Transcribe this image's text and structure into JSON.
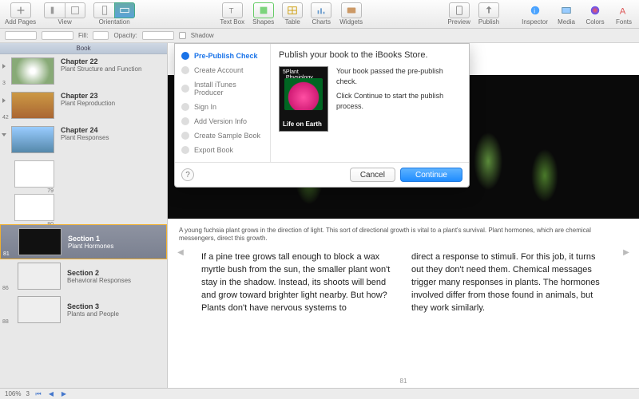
{
  "toolbar": {
    "add_pages": "Add Pages",
    "view": "View",
    "orientation": "Orientation",
    "text_box": "Text Box",
    "shapes": "Shapes",
    "table": "Table",
    "charts": "Charts",
    "widgets": "Widgets",
    "preview": "Preview",
    "publish": "Publish",
    "inspector": "Inspector",
    "media": "Media",
    "colors": "Colors",
    "fonts": "Fonts"
  },
  "subbar": {
    "fill": "Fill:",
    "opacity": "Opacity:",
    "shadow": "Shadow"
  },
  "sidebar": {
    "header": "Book",
    "chapters": [
      {
        "title": "Chapter 22",
        "sub": "Plant Structure and Function",
        "num": "3"
      },
      {
        "title": "Chapter 23",
        "sub": "Plant Reproduction",
        "num": "42"
      },
      {
        "title": "Chapter 24",
        "sub": "Plant Responses",
        "num": ""
      }
    ],
    "pages": [
      {
        "num": "79"
      },
      {
        "num": "80"
      }
    ],
    "sections": [
      {
        "title": "Section 1",
        "sub": "Plant Hormones",
        "num": "81"
      },
      {
        "title": "Section 2",
        "sub": "Behavioral Responses",
        "num": "86"
      },
      {
        "title": "Section 3",
        "sub": "Plants and People",
        "num": "88"
      }
    ]
  },
  "modal": {
    "steps": [
      "Pre-Publish Check",
      "Create Account",
      "Install iTunes Producer",
      "Sign In",
      "Add Version Info",
      "Create Sample Book",
      "Export Book"
    ],
    "title": "Publish your book to the iBooks Store.",
    "cover_num": "5",
    "cover_subject": "Plant Physiology",
    "cover_title": "Life on Earth",
    "msg1": "Your book passed the pre-publish check.",
    "msg2": "Click Continue to start the publish process.",
    "help": "?",
    "cancel": "Cancel",
    "continue": "Continue"
  },
  "document": {
    "caption": "A young fuchsia plant grows in the direction of light. This sort of directional growth is vital to a plant's survival. Plant hormones, which are chemical messengers, direct this growth.",
    "col1": "If a pine tree grows tall enough to block a wax myrtle bush from the sun, the smaller plant won't stay in the shadow. Instead, its shoots will bend and grow toward brighter light nearby. But how? Plants don't have nervous systems to",
    "col2": "direct a response to stimuli. For this job, it turns out they don't need them. Chemical messages trigger many responses in plants. The hormones involved differ from those found in animals, but they work similarly.",
    "page_number": "81"
  },
  "bottombar": {
    "zoom": "106%",
    "page": "3"
  }
}
